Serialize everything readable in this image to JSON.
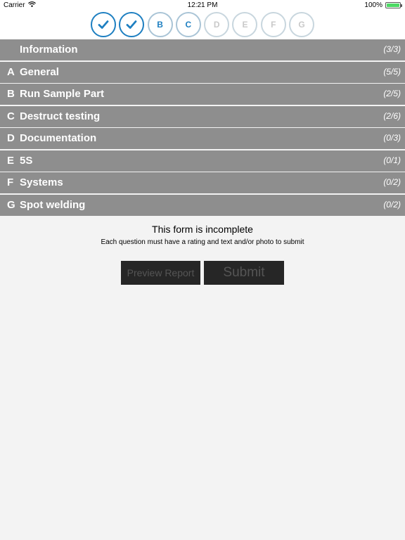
{
  "status_bar": {
    "carrier": "Carrier",
    "time": "12:21 PM",
    "battery": "100%"
  },
  "steps": [
    {
      "label": "",
      "state": "done"
    },
    {
      "label": "",
      "state": "done"
    },
    {
      "label": "B",
      "state": "current"
    },
    {
      "label": "C",
      "state": "current"
    },
    {
      "label": "D",
      "state": "pending"
    },
    {
      "label": "E",
      "state": "pending"
    },
    {
      "label": "F",
      "state": "pending"
    },
    {
      "label": "G",
      "state": "pending"
    }
  ],
  "sections": [
    {
      "letter": "",
      "title": "Information",
      "count": "(3/3)"
    },
    {
      "letter": "A",
      "title": "General",
      "count": "(5/5)"
    },
    {
      "letter": "B",
      "title": "Run Sample Part",
      "count": "(2/5)"
    },
    {
      "letter": "C",
      "title": "Destruct testing",
      "count": "(2/6)"
    },
    {
      "letter": "D",
      "title": "Documentation",
      "count": "(0/3)"
    },
    {
      "letter": "E",
      "title": "5S",
      "count": "(0/1)"
    },
    {
      "letter": "F",
      "title": "Systems",
      "count": "(0/2)"
    },
    {
      "letter": "G",
      "title": "Spot welding",
      "count": "(0/2)"
    }
  ],
  "notice": {
    "title": "This form is incomplete",
    "subtitle": "Each question must have a rating and text and/or photo to submit"
  },
  "buttons": {
    "preview": "Preview Report",
    "submit": "Submit"
  },
  "colors": {
    "accent": "#1e7fc1",
    "section_bg": "#8e8e8e",
    "button_bg": "#262626",
    "battery": "#4cd964"
  }
}
